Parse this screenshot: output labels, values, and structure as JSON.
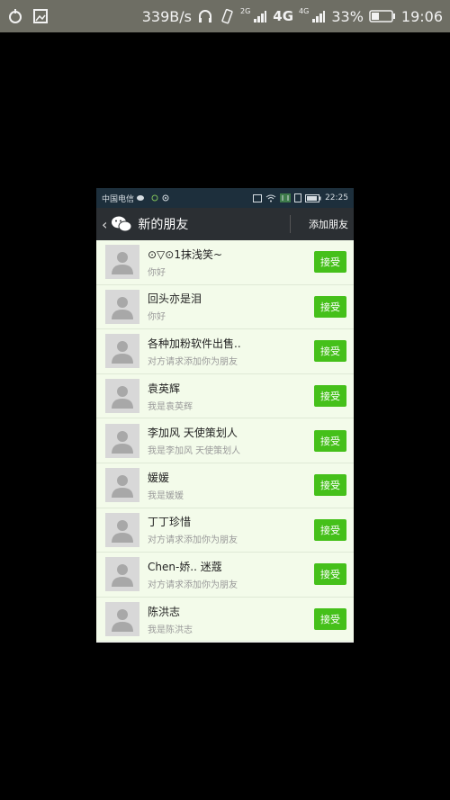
{
  "outer_status": {
    "speed": "339B/s",
    "net_2g": "2G",
    "net_4g": "4G",
    "net_4g_small": "4G",
    "battery": "33%",
    "time": "19:06"
  },
  "inner_status": {
    "carrier": "中国电信",
    "time": "22:25"
  },
  "header": {
    "back": "‹",
    "title": "新的朋友",
    "add_friend": "添加朋友"
  },
  "requests": [
    {
      "name": "⊙▽⊙1抹浅笑~",
      "message": "你好",
      "button": "接受"
    },
    {
      "name": "回头亦是泪",
      "message": "你好",
      "button": "接受"
    },
    {
      "name": " 各种加粉软件出售..",
      "message": "对方请求添加你为朋友",
      "button": "接受"
    },
    {
      "name": "袁英辉",
      "message": "我是袁英辉",
      "button": "接受"
    },
    {
      "name": "李加风 天使策划人",
      "message": "我是李加风 天使策划人",
      "button": "接受"
    },
    {
      "name": "媛媛",
      "message": "我是媛媛",
      "button": "接受"
    },
    {
      "name": "丁丁珍惜",
      "message": "对方请求添加你为朋友",
      "button": "接受"
    },
    {
      "name": "Chen-娇.. 迷蔻",
      "message": "对方请求添加你为朋友",
      "button": "接受"
    },
    {
      "name": "陈洪志",
      "message": "我是陈洪志",
      "button": "接受"
    }
  ],
  "colors": {
    "accept_green": "#45c01a",
    "list_bg": "#f3fbea",
    "header_bg": "#2b2f33"
  }
}
